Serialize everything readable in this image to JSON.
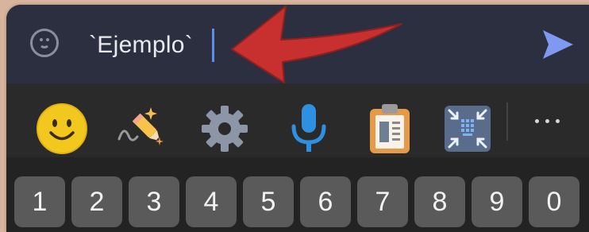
{
  "compose": {
    "text": "`Ejemplo`",
    "emoji_icon": "smiley-outline-icon",
    "send_icon": "send-icon"
  },
  "annotation": {
    "arrow_icon": "red-arrow-icon",
    "arrow_color": "#c7302f"
  },
  "toolbar": {
    "items": [
      {
        "icon": "emoji-icon"
      },
      {
        "icon": "handwriting-pen-icon"
      },
      {
        "icon": "settings-gear-icon"
      },
      {
        "icon": "microphone-icon"
      },
      {
        "icon": "clipboard-icon"
      },
      {
        "icon": "resize-keyboard-icon"
      }
    ],
    "more_icon": "more-dots-icon"
  },
  "number_row": [
    "1",
    "2",
    "3",
    "4",
    "5",
    "6",
    "7",
    "8",
    "9",
    "0"
  ],
  "colors": {
    "compose_bg": "#2b2f3f",
    "toolbar_bg": "#2a2a2a",
    "key_bg": "#5a5a5a",
    "send_accent": "#7f99f0",
    "caret": "#5e8ee8",
    "outer_bg": "#d8b49c"
  }
}
